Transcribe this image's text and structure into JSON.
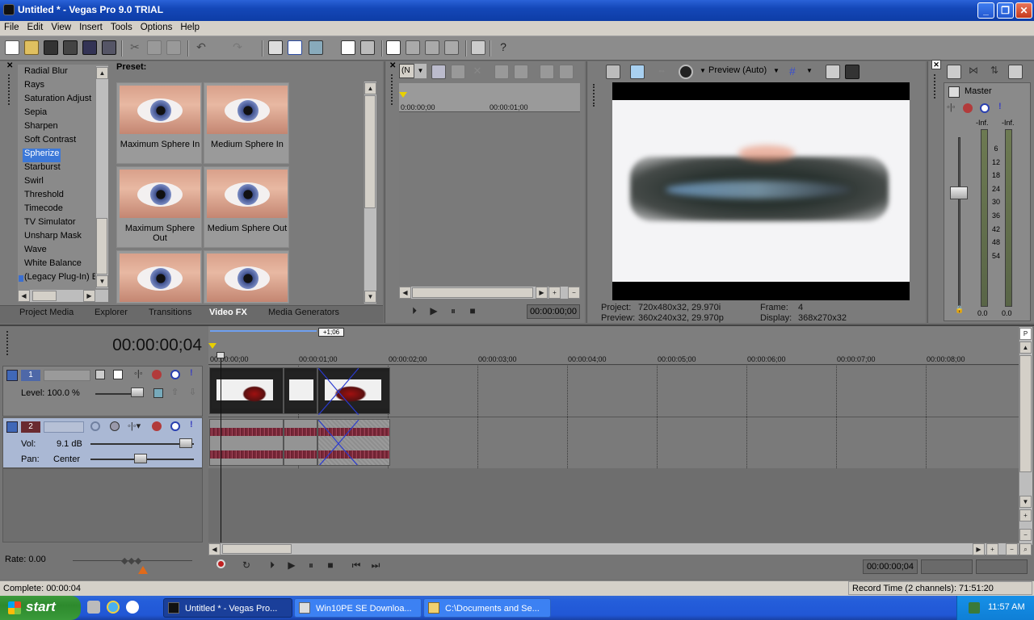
{
  "window": {
    "title": "Untitled * - Vegas Pro 9.0 TRIAL"
  },
  "menu": [
    "File",
    "Edit",
    "View",
    "Insert",
    "Tools",
    "Options",
    "Help"
  ],
  "fx_list": [
    "Radial Blur",
    "Rays",
    "Saturation Adjust",
    "Sepia",
    "Sharpen",
    "Soft Contrast",
    "Spherize",
    "Starburst",
    "Swirl",
    "Threshold",
    "Timecode",
    "TV Simulator",
    "Unsharp Mask",
    "Wave",
    "White Balance",
    "(Legacy Plug-In) B"
  ],
  "fx_selected": "Spherize",
  "presets": {
    "label": "Preset:",
    "items": [
      "Maximum Sphere In",
      "Medium Sphere In",
      "Maximum Sphere Out",
      "Medium Sphere Out",
      "",
      ""
    ]
  },
  "tabs": [
    "Project Media",
    "Explorer",
    "Transitions",
    "Video FX",
    "Media Generators"
  ],
  "active_tab": "Video FX",
  "trimmer": {
    "combo": "(N",
    "ruler_start": "0:00:00;00",
    "ruler_mid": "00:00:01;00",
    "timecode": "00:00:00;00"
  },
  "preview": {
    "mode": "Preview (Auto)",
    "project_label": "Project:",
    "project_value": "720x480x32, 29.970i",
    "preview_label": "Preview:",
    "preview_value": "360x240x32, 29.970p",
    "frame_label": "Frame:",
    "frame_value": "4",
    "display_label": "Display:",
    "display_value": "368x270x32"
  },
  "master": {
    "label": "Master",
    "peak_left": "-Inf.",
    "peak_right": "-Inf.",
    "scale": [
      "6",
      "12",
      "18",
      "24",
      "30",
      "36",
      "42",
      "48",
      "54"
    ],
    "bottom_left": "0.0",
    "bottom_right": "0.0"
  },
  "timeline": {
    "cursor_time": "00:00:00;04",
    "region_label": "+1;06",
    "marks": [
      "00:00:00;00",
      "00:00:01;00",
      "00:00:02;00",
      "00:00:03;00",
      "00:00:04;00",
      "00:00:05;00",
      "00:00:06;00",
      "00:00:07;00",
      "00:00:08;00"
    ],
    "video_track": {
      "number": "1",
      "level_label": "Level: 100.0 %"
    },
    "audio_track": {
      "number": "2",
      "vol_label": "Vol:",
      "vol_value": "9.1 dB",
      "pan_label": "Pan:",
      "pan_value": "Center"
    },
    "rate_label": "Rate: 0.00",
    "transport_time": "00:00:00;04"
  },
  "status": {
    "left": "Complete: 00:00:04",
    "right": "Record Time (2 channels): 71:51:20"
  },
  "taskbar": {
    "start": "start",
    "items": [
      "Untitled * - Vegas Pro...",
      "Win10PE SE Downloa...",
      "C:\\Documents and Se..."
    ],
    "clock": "11:57 AM"
  },
  "colors": {
    "titlebar": "#1447b8",
    "selection": "#3c78d8",
    "track_selected": "#aab8d4",
    "taskbar": "#245edb",
    "start": "#2d8a2d"
  }
}
